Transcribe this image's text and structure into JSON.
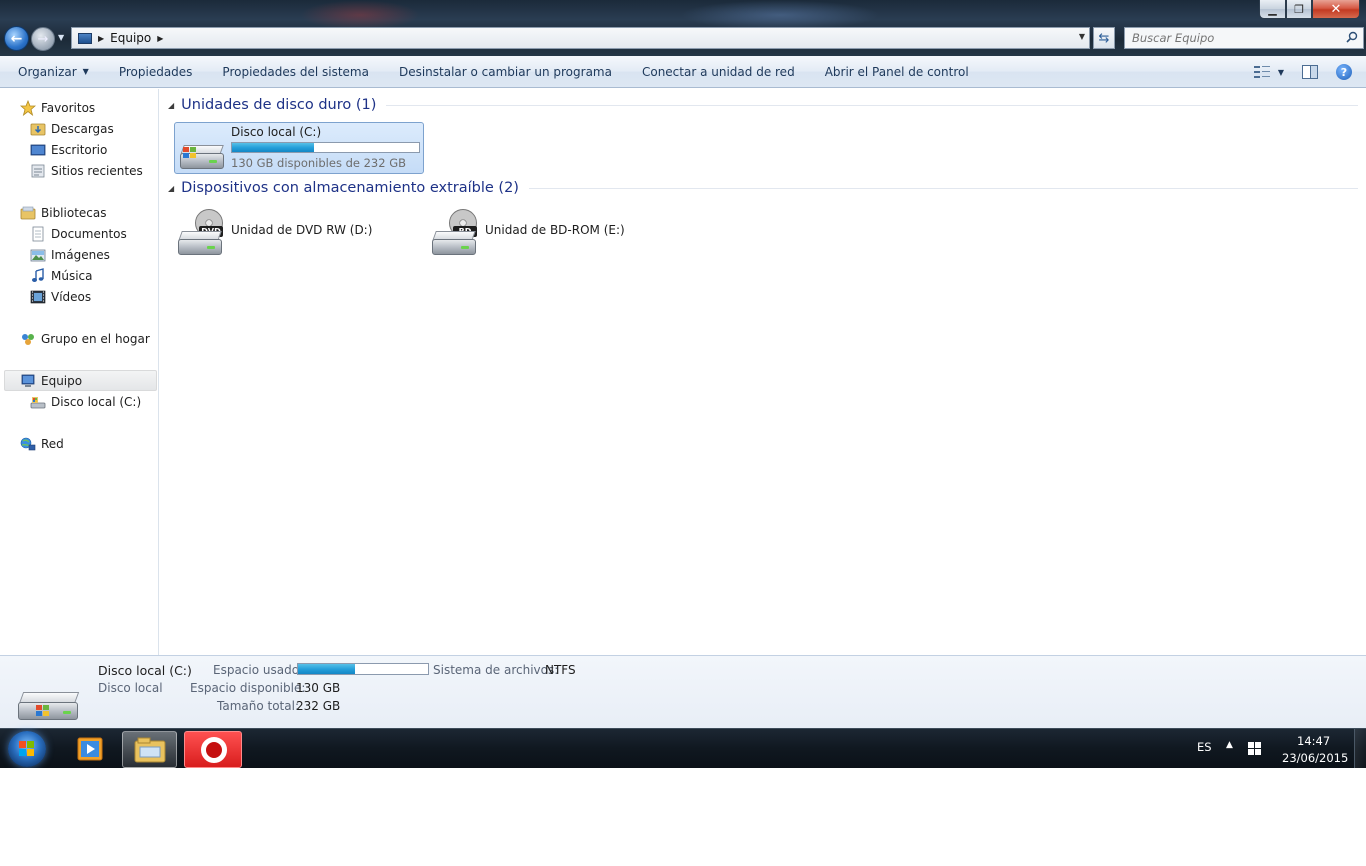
{
  "window": {
    "address": {
      "crumbs": [
        "Equipo"
      ]
    },
    "search": {
      "placeholder": "Buscar Equipo"
    }
  },
  "commandbar": {
    "organize": "Organizar",
    "properties": "Propiedades",
    "system_properties": "Propiedades del sistema",
    "uninstall": "Desinstalar o cambiar un programa",
    "map_drive": "Conectar a unidad de red",
    "control_panel": "Abrir el Panel de control"
  },
  "navpane": {
    "favorites": {
      "label": "Favoritos",
      "items": [
        "Descargas",
        "Escritorio",
        "Sitios recientes"
      ]
    },
    "libraries": {
      "label": "Bibliotecas",
      "items": [
        "Documentos",
        "Imágenes",
        "Música",
        "Vídeos"
      ]
    },
    "homegroup": {
      "label": "Grupo en el hogar"
    },
    "computer": {
      "label": "Equipo",
      "items": [
        "Disco local (C:)"
      ]
    },
    "network": {
      "label": "Red"
    }
  },
  "content": {
    "hard_drives": {
      "header": "Unidades de disco duro (1)",
      "items": [
        {
          "name": "Disco local (C:)",
          "free_text": "130 GB disponibles de 232 GB",
          "used_fraction": 0.44
        }
      ]
    },
    "removable": {
      "header": "Dispositivos con almacenamiento extraíble (2)",
      "items": [
        {
          "name": "Unidad de DVD RW (D:)",
          "disc_label": "DVD"
        },
        {
          "name": "Unidad de BD-ROM (E:)",
          "disc_label": "BD"
        }
      ]
    }
  },
  "details": {
    "name": "Disco local (C:)",
    "type": "Disco local",
    "used_label": "Espacio usado:",
    "used_fraction": 0.44,
    "free_label": "Espacio disponible:",
    "free_value": "130 GB",
    "total_label": "Tamaño total:",
    "total_value": "232 GB",
    "fs_label": "Sistema de archivos:",
    "fs_value": "NTFS"
  },
  "taskbar": {
    "language": "ES",
    "time": "14:47",
    "date": "23/06/2015"
  },
  "colors": {
    "accent": "#26a0da",
    "group_header": "#1e3287",
    "opera_red": "#d81d1d"
  }
}
